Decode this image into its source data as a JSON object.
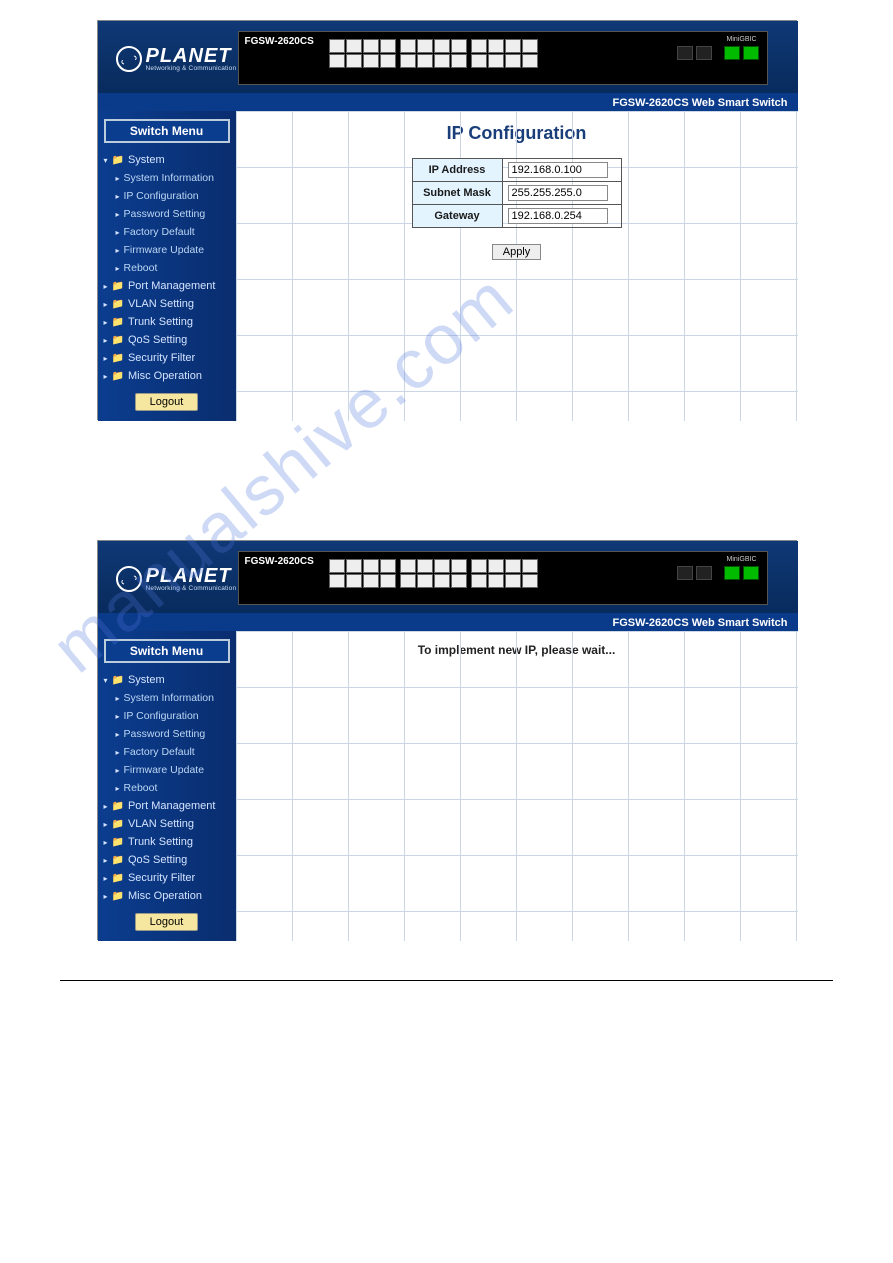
{
  "watermark": "manualshive.com",
  "brand": {
    "name": "PLANET",
    "tagline": "Networking & Communication"
  },
  "device_model": "FGSW-2620CS",
  "aux_label": "MiniGBIC",
  "subtitle": "FGSW-2620CS Web Smart Switch",
  "sidebar": {
    "header": "Switch Menu",
    "items": [
      {
        "label": "System",
        "key": "system"
      },
      {
        "label": "System Information",
        "key": "sysinfo",
        "lvl": 2
      },
      {
        "label": "IP Configuration",
        "key": "ipconf",
        "lvl": 2
      },
      {
        "label": "Password Setting",
        "key": "pwd",
        "lvl": 2
      },
      {
        "label": "Factory Default",
        "key": "factory",
        "lvl": 2
      },
      {
        "label": "Firmware Update",
        "key": "fw",
        "lvl": 2
      },
      {
        "label": "Reboot",
        "key": "reboot",
        "lvl": 2
      },
      {
        "label": "Port Management",
        "key": "portmgmt"
      },
      {
        "label": "VLAN Setting",
        "key": "vlan"
      },
      {
        "label": "Trunk Setting",
        "key": "trunk"
      },
      {
        "label": "QoS Setting",
        "key": "qos"
      },
      {
        "label": "Security Filter",
        "key": "sec"
      },
      {
        "label": "Misc Operation",
        "key": "misc"
      }
    ],
    "logout": "Logout"
  },
  "screen1": {
    "title": "IP Configuration",
    "fields": {
      "ip_label": "IP Address",
      "ip_value": "192.168.0.100",
      "mask_label": "Subnet Mask",
      "mask_value": "255.255.255.0",
      "gw_label": "Gateway",
      "gw_value": "192.168.0.254"
    },
    "apply": "Apply"
  },
  "screen2": {
    "message": "To implement new IP, please wait..."
  }
}
